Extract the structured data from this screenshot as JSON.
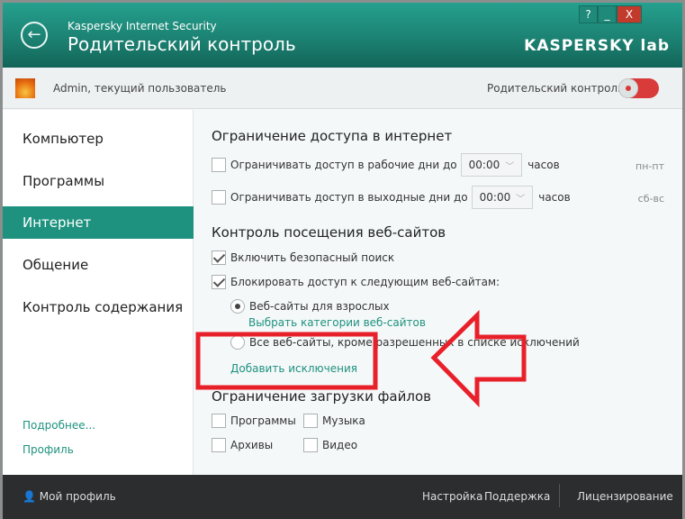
{
  "header": {
    "app_name": "Kaspersky Internet Security",
    "title": "Родительский контроль",
    "logo": "KASPERSKY lab",
    "help": "?",
    "minimize": "_",
    "close": "X",
    "back_icon": "arrow-left-icon"
  },
  "userbar": {
    "user": "Admin, текущий пользователь",
    "toggle_label": "Родительский контроль",
    "toggle_on": true
  },
  "sidebar": {
    "items": [
      {
        "label": "Компьютер"
      },
      {
        "label": "Программы"
      },
      {
        "label": "Интернет",
        "active": true
      },
      {
        "label": "Общение"
      },
      {
        "label": "Контроль содержания"
      }
    ],
    "more": "Подробнее...",
    "profile": "Профиль"
  },
  "main": {
    "internet_heading": "Ограничение доступа в интернет",
    "weekdays": {
      "label": "Ограничивать доступ в рабочие дни до",
      "time": "00:00",
      "unit": "часов",
      "days": "пн-пт",
      "checked": false
    },
    "weekend": {
      "label": "Ограничивать доступ в выходные дни до",
      "time": "00:00",
      "unit": "часов",
      "days": "сб-вс",
      "checked": false
    },
    "web_heading": "Контроль посещения веб-сайтов",
    "safe_search": {
      "label": "Включить безопасный поиск",
      "checked": true
    },
    "block": {
      "label": "Блокировать доступ к следующим веб-сайтам:",
      "checked": true
    },
    "adult": {
      "label": "Веб-сайты для взрослых",
      "selected": true
    },
    "choose_categories": "Выбрать категории веб-сайтов",
    "all_except": {
      "label": "Все веб-сайты, кроме разрешенных в списке исключений",
      "selected": false
    },
    "add_exceptions": "Добавить исключения",
    "files_heading": "Ограничение загрузки файлов",
    "files": [
      {
        "label": "Программы"
      },
      {
        "label": "Музыка"
      },
      {
        "label": "Архивы"
      },
      {
        "label": "Видео"
      }
    ]
  },
  "footer": {
    "profile": "Мой профиль",
    "settings": "Настройка",
    "support": "Поддержка",
    "licensing": "Лицензирование"
  },
  "colors": {
    "accent": "#1e927f",
    "annotation": "#e8202a"
  }
}
